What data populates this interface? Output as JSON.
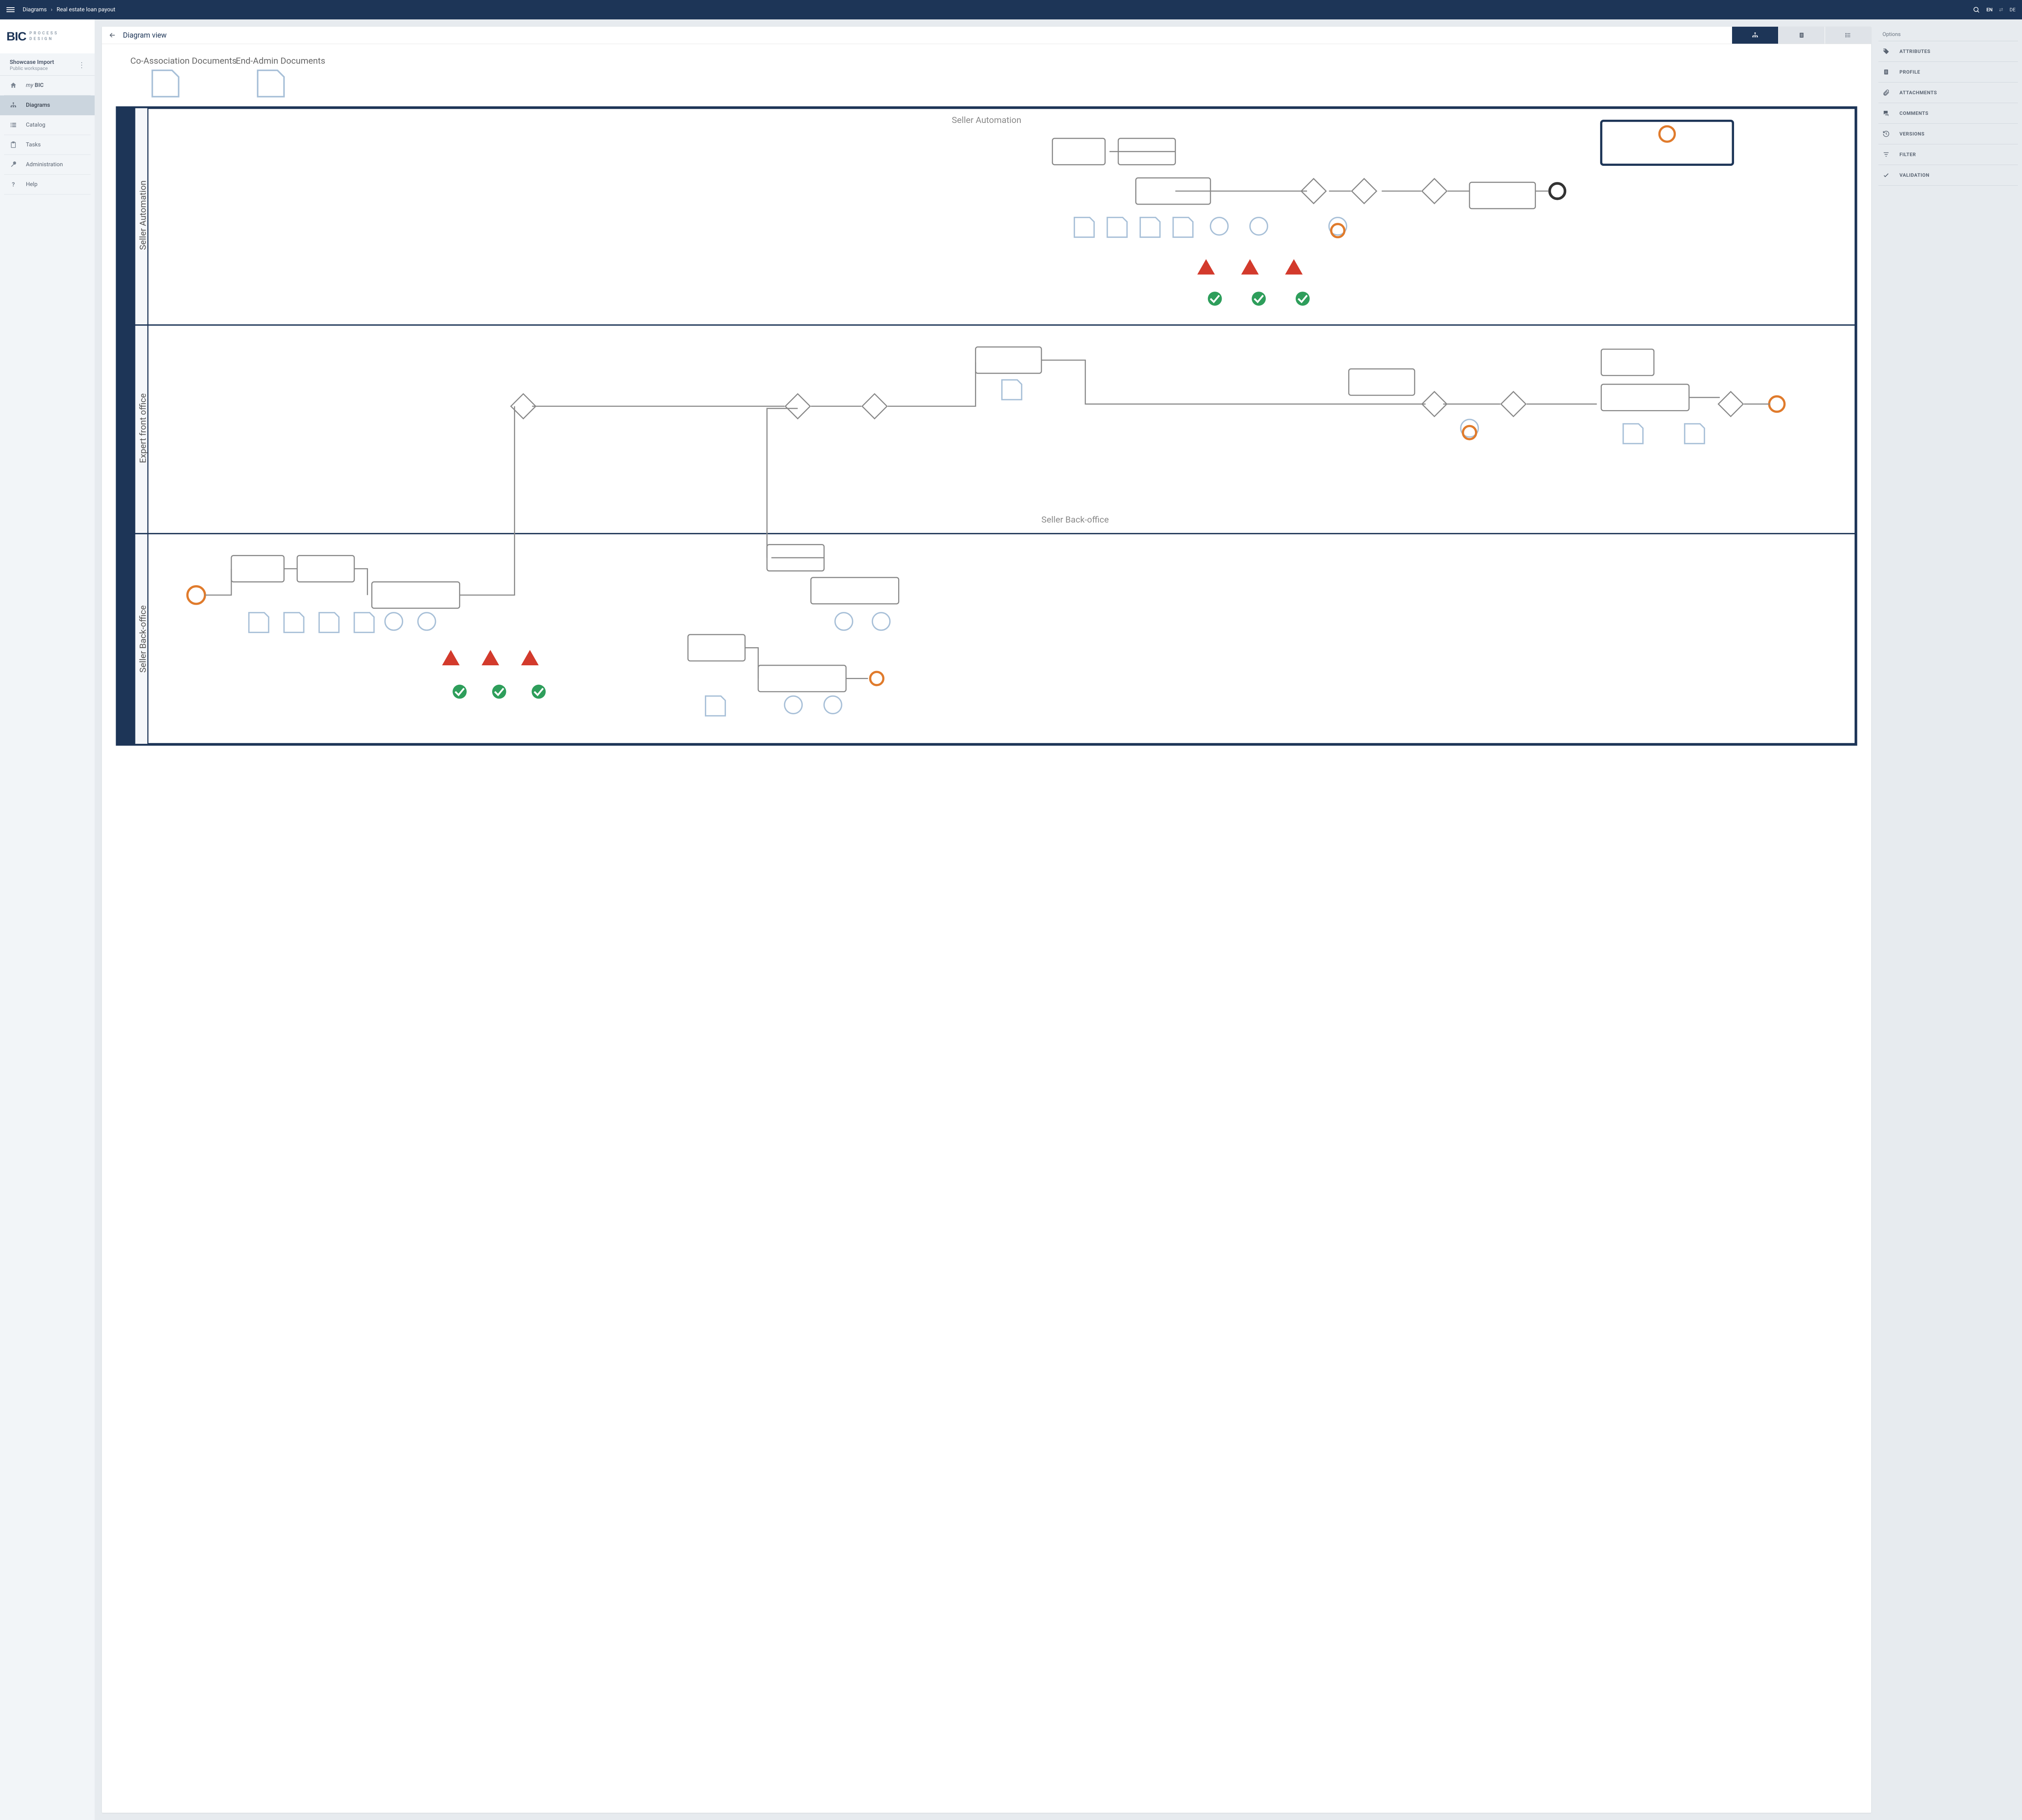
{
  "topbar": {
    "breadcrumb_root": "Diagrams",
    "breadcrumb_current": "Real estate loan payout",
    "lang_en": "EN",
    "lang_de": "DE"
  },
  "logo": {
    "brand": "BIC",
    "sub1": "PROCESS",
    "sub2": "DESIGN"
  },
  "workspace": {
    "title": "Showcase Import",
    "subtitle": "Public workspace"
  },
  "nav": {
    "mybic_prefix": "my ",
    "mybic_strong": "BIC",
    "diagrams": "Diagrams",
    "catalog": "Catalog",
    "tasks": "Tasks",
    "administration": "Administration",
    "help": "Help"
  },
  "card": {
    "title": "Diagram view"
  },
  "options": {
    "header": "Options",
    "attributes": "ATTRIBUTES",
    "profile": "PROFILE",
    "attachments": "ATTACHMENTS",
    "comments": "COMMENTS",
    "versions": "VERSIONS",
    "filter": "FILTER",
    "validation": "VALIDATION"
  },
  "diagram": {
    "lanes": [
      {
        "id": "lane1",
        "label": "Seller Automation"
      },
      {
        "id": "lane2",
        "label": "Expert front office"
      },
      {
        "id": "lane3",
        "label": "Seller Back-office"
      }
    ],
    "header_docs": [
      "Co-Association Documents",
      "End-Admin Documents"
    ],
    "colors": {
      "lane_border": "#1d3557",
      "task_border": "#6a7480",
      "event_orange": "#e07b2c",
      "warning_red": "#d33a2c",
      "ok_green": "#2e9e5b",
      "role_blue": "#a8c0d8"
    },
    "note": "BPMN-style process with three horizontal swimlanes; contains multiple sequential activities, gateways (diamonds), start/end events (circles), data objects (page icons), warning/error triangles in red, and green checkmark circles beneath several tasks."
  }
}
